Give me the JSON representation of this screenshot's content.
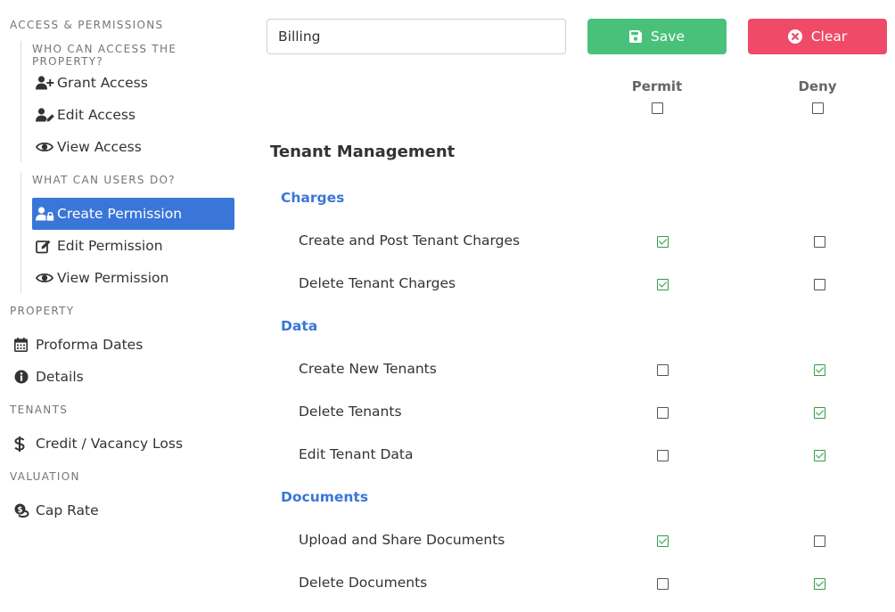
{
  "sidebar": {
    "access_section": "ACCESS & PERMISSIONS",
    "who_label": "WHO CAN ACCESS THE PROPERTY?",
    "who_items": [
      {
        "label": "Grant Access",
        "icon": "user-plus-icon"
      },
      {
        "label": "Edit Access",
        "icon": "user-edit-icon"
      },
      {
        "label": "View Access",
        "icon": "eye-icon"
      }
    ],
    "what_label": "WHAT CAN USERS DO?",
    "what_items": [
      {
        "label": "Create Permission",
        "icon": "user-lock-icon",
        "active": true
      },
      {
        "label": "Edit Permission",
        "icon": "edit-icon",
        "active": false
      },
      {
        "label": "View Permission",
        "icon": "eye-icon",
        "active": false
      }
    ],
    "property_section": "PROPERTY",
    "property_items": [
      {
        "label": "Proforma Dates",
        "icon": "calendar-icon"
      },
      {
        "label": "Details",
        "icon": "info-circle-icon"
      }
    ],
    "tenants_section": "TENANTS",
    "tenants_items": [
      {
        "label": "Credit / Vacancy Loss",
        "icon": "dollar-icon"
      }
    ],
    "valuation_section": "VALUATION",
    "valuation_items": [
      {
        "label": "Cap Rate",
        "icon": "coins-icon"
      }
    ]
  },
  "toolbar": {
    "name_value": "Billing",
    "save_label": "Save",
    "clear_label": "Clear"
  },
  "columns": {
    "permit": "Permit",
    "deny": "Deny",
    "permit_all_checked": false,
    "deny_all_checked": false
  },
  "section_title": "Tenant Management",
  "groups": [
    {
      "title": "Charges",
      "items": [
        {
          "label": "Create and Post Tenant Charges",
          "permit": true,
          "deny": false
        },
        {
          "label": "Delete Tenant Charges",
          "permit": true,
          "deny": false
        }
      ]
    },
    {
      "title": "Data",
      "items": [
        {
          "label": "Create New Tenants",
          "permit": false,
          "deny": true
        },
        {
          "label": "Delete Tenants",
          "permit": false,
          "deny": true
        },
        {
          "label": "Edit Tenant Data",
          "permit": false,
          "deny": true
        }
      ]
    },
    {
      "title": "Documents",
      "items": [
        {
          "label": "Upload and Share Documents",
          "permit": true,
          "deny": false
        },
        {
          "label": "Delete Documents",
          "permit": false,
          "deny": true
        }
      ]
    }
  ],
  "colors": {
    "accent": "#3a76d8",
    "save": "#4ac17a",
    "clear": "#ef4a67",
    "check": "#2f9e44"
  }
}
